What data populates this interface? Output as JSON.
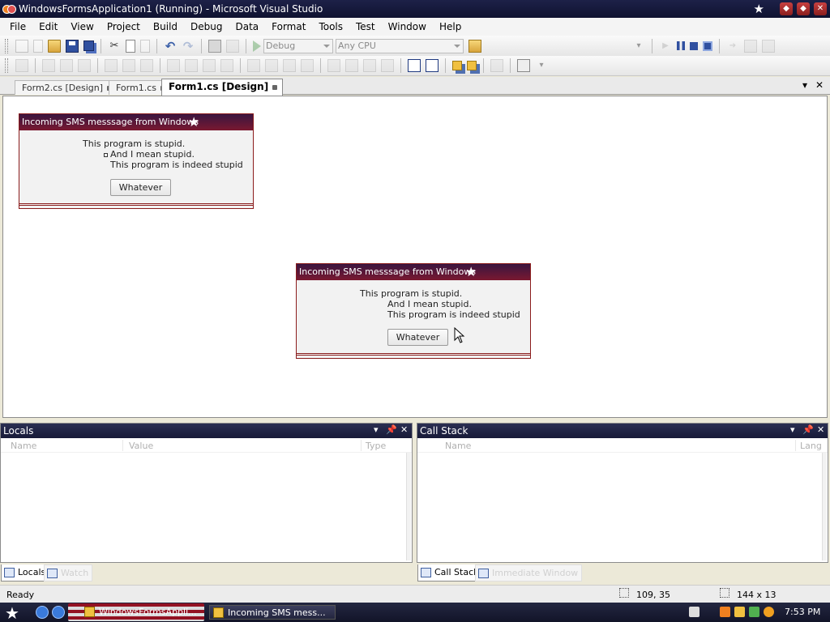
{
  "window": {
    "title": "WindowsFormsApplication1 (Running) - Microsoft Visual Studio"
  },
  "menu": [
    "File",
    "Edit",
    "View",
    "Project",
    "Build",
    "Debug",
    "Data",
    "Format",
    "Tools",
    "Test",
    "Window",
    "Help"
  ],
  "toolbar": {
    "config": "Debug",
    "platform": "Any CPU"
  },
  "doc_tabs": [
    "Form2.cs [Design]",
    "Form1.cs",
    "Form1.cs [Design]"
  ],
  "active_tab_index": 2,
  "sms_form_1": {
    "title": "Incoming SMS messsage from Windows",
    "line1": "This program is stupid.",
    "line2": "And I mean stupid.",
    "line3": "This program is indeed stupid",
    "button": "Whatever"
  },
  "sms_form_2": {
    "title": "Incoming SMS messsage from Windows",
    "line1": "This program is stupid.",
    "line2": "And I mean stupid.",
    "line3": "This program is indeed stupid",
    "button": "Whatever"
  },
  "locals_pane": {
    "title": "Locals",
    "columns": [
      "Name",
      "Value",
      "Type"
    ],
    "tabs": [
      "Locals",
      "Watch"
    ]
  },
  "callstack_pane": {
    "title": "Call Stack",
    "columns": [
      "Name",
      "Lang"
    ],
    "tabs": [
      "Call Stack",
      "Immediate Window"
    ]
  },
  "status": {
    "text": "Ready",
    "position": "109, 35",
    "size": "144 x 13"
  },
  "taskbar": {
    "tasks": [
      "WindowsFormsAppli...",
      "Incoming SMS mess..."
    ],
    "clock": "7:53 PM"
  },
  "colors": {
    "titlebar": "#171a38",
    "form_header": "#7a1830",
    "accent_border": "#8b1c1c"
  }
}
